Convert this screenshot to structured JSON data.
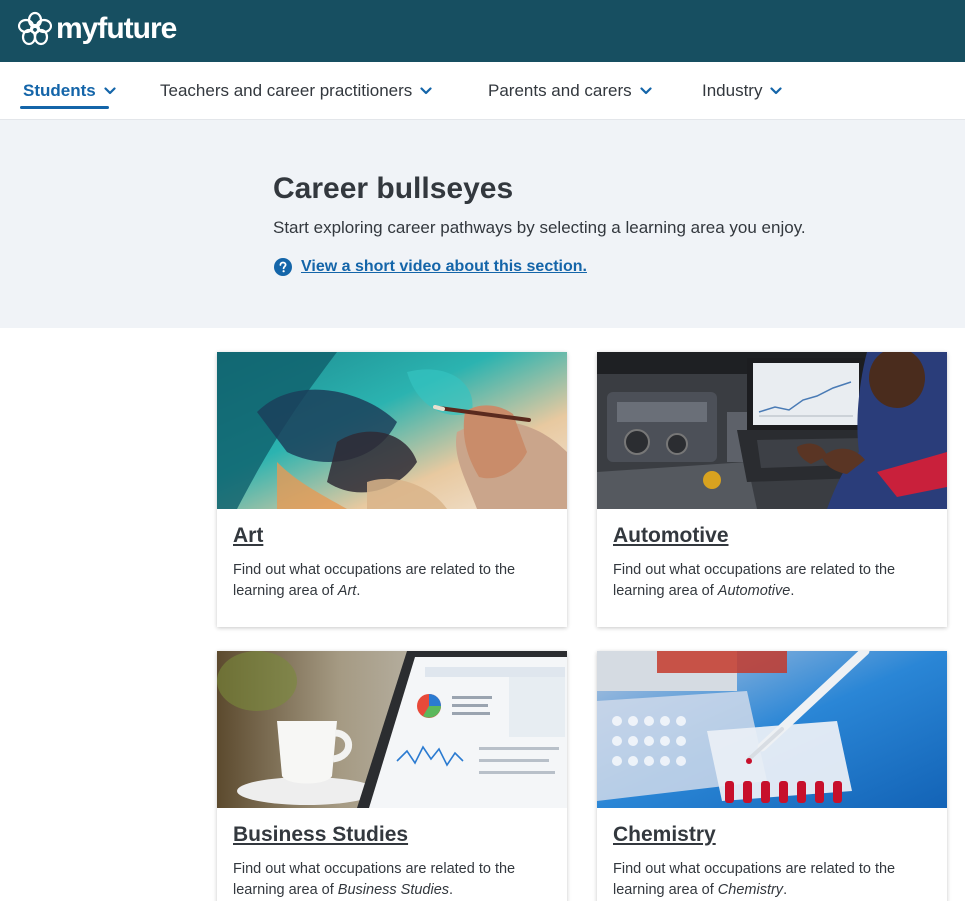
{
  "header": {
    "brand": "myfuture"
  },
  "nav": {
    "items": [
      {
        "label": "Students",
        "active": true
      },
      {
        "label": "Teachers and career practitioners",
        "active": false
      },
      {
        "label": "Parents and carers",
        "active": false
      },
      {
        "label": "Industry",
        "active": false
      }
    ]
  },
  "hero": {
    "title": "Career bullseyes",
    "subtitle": "Start exploring career pathways by selecting a learning area you enjoy.",
    "link": "View a short video about this section."
  },
  "cards": [
    {
      "title": "Art",
      "desc_prefix": "Find out what occupations are related to the learning area of ",
      "desc_area": "Art",
      "desc_suffix": "."
    },
    {
      "title": "Automotive",
      "desc_prefix": "Find out what occupations are related to the learning area of ",
      "desc_area": "Automotive",
      "desc_suffix": "."
    },
    {
      "title": "Business Studies",
      "desc_prefix": "Find out what occupations are related to the learning area of ",
      "desc_area": "Business Studies",
      "desc_suffix": "."
    },
    {
      "title": "Chemistry",
      "desc_prefix": "Find out what occupations are related to the learning area of ",
      "desc_area": "Chemistry",
      "desc_suffix": "."
    }
  ],
  "colors": {
    "header_bg": "#174f61",
    "accent": "#1465a9",
    "hero_bg": "#f0f3f7",
    "text": "#33383e"
  },
  "icons": {
    "logo": "myfuture-flower-logo",
    "nav_chevron": "chevron-down-icon",
    "help": "question-circle-icon"
  }
}
